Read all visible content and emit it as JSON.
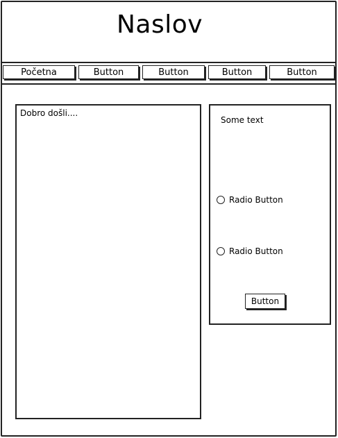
{
  "header": {
    "title": "Naslov"
  },
  "nav": {
    "items": [
      {
        "label": "Početna"
      },
      {
        "label": "Button"
      },
      {
        "label": "Button"
      },
      {
        "label": "Button"
      },
      {
        "label": "Button"
      }
    ]
  },
  "main": {
    "welcome_text": "Dobro došli...."
  },
  "sidebar": {
    "text": "Some text",
    "radios": [
      {
        "label": "Radio Button",
        "selected": false
      },
      {
        "label": "Radio Button",
        "selected": false
      }
    ],
    "button_label": "Button"
  }
}
